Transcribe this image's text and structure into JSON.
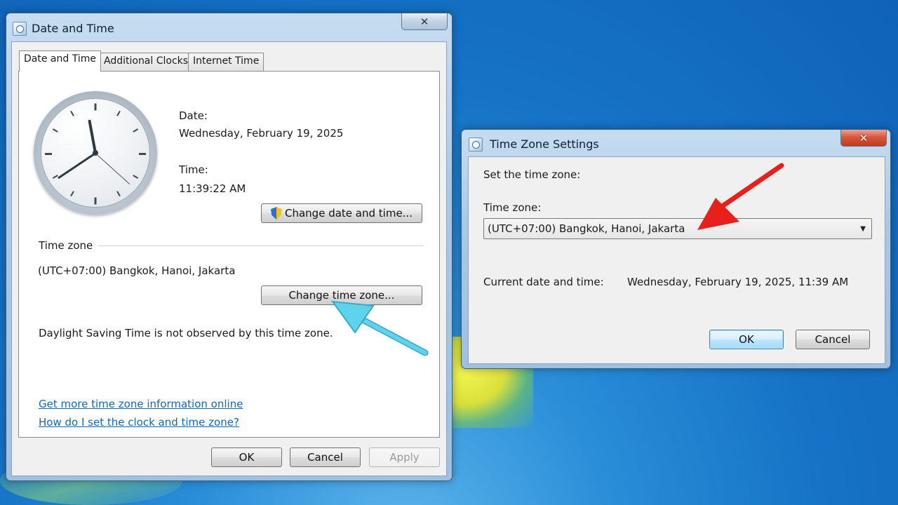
{
  "dialog_main": {
    "title": "Date and Time",
    "close_label": "✕",
    "tabs": [
      {
        "label": "Date and Time"
      },
      {
        "label": "Additional Clocks"
      },
      {
        "label": "Internet Time"
      }
    ],
    "date_label": "Date:",
    "date_value": "Wednesday, February 19, 2025",
    "time_label": "Time:",
    "time_value": "11:39:22 AM",
    "change_datetime_button": "Change date and time...",
    "timezone_section_label": "Time zone",
    "timezone_value": "(UTC+07:00) Bangkok, Hanoi, Jakarta",
    "change_timezone_button": "Change time zone...",
    "dst_note": "Daylight Saving Time is not observed by this time zone.",
    "links": [
      {
        "label": "Get more time zone information online"
      },
      {
        "label": "How do I set the clock and time zone?"
      }
    ],
    "ok_button": "OK",
    "cancel_button": "Cancel",
    "apply_button": "Apply"
  },
  "dialog_tz": {
    "title": "Time Zone Settings",
    "close_label": "✕",
    "instruction": "Set the time zone:",
    "timezone_label": "Time zone:",
    "timezone_selected": "(UTC+07:00) Bangkok, Hanoi, Jakarta",
    "current_label": "Current date and time:",
    "current_value": "Wednesday, February 19, 2025, 11:39 AM",
    "ok_button": "OK",
    "cancel_button": "Cancel"
  },
  "clock": {
    "hours": 11,
    "minutes": 39,
    "seconds": 22
  },
  "colors": {
    "link": "#0f68b8",
    "annotation_red": "#e8201c",
    "annotation_cyan": "#4ecbe8"
  },
  "icons": {
    "title_icon": "date-time-icon",
    "shield": "uac-shield-icon",
    "dropdown": "chevron-down-icon",
    "close": "close-icon"
  }
}
